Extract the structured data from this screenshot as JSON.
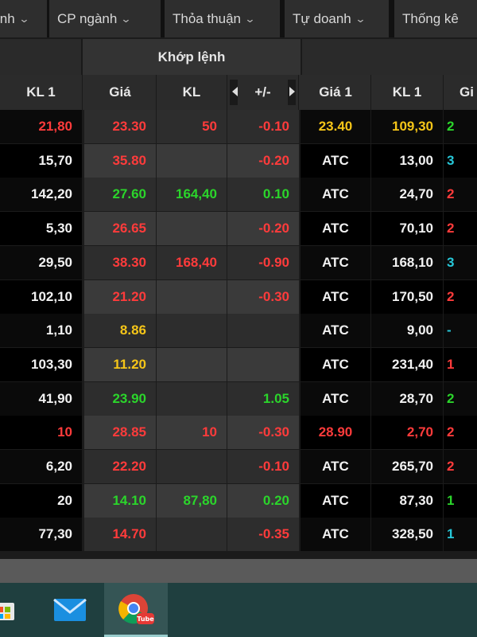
{
  "menu": {
    "items": [
      {
        "label": "inh"
      },
      {
        "label": "CP ngành"
      },
      {
        "label": "Thỏa thuận"
      },
      {
        "label": "Tự doanh"
      },
      {
        "label": "Thống kê"
      }
    ]
  },
  "group_header": {
    "khop_lenh": "Khớp lệnh"
  },
  "columns": {
    "kl1": "KL 1",
    "gia": "Giá",
    "kl": "KL",
    "pm": "+/-",
    "gia1": "Giá 1",
    "kl1b": "KL 1",
    "gi": "Gi"
  },
  "rows": [
    {
      "kl1": "21,80",
      "kl1_c": "red",
      "gia": "23.30",
      "gia_c": "red",
      "kl": "50",
      "kl_c": "red",
      "pm": "-0.10",
      "pm_c": "red",
      "gia1": "23.40",
      "gia1_c": "yellow",
      "kl1b": "109,30",
      "kl1b_c": "yellow",
      "gi": "2",
      "gi_c": "green"
    },
    {
      "kl1": "15,70",
      "kl1_c": "white",
      "gia": "35.80",
      "gia_c": "red",
      "kl": "",
      "kl_c": "white",
      "pm": "-0.20",
      "pm_c": "red",
      "gia1": "ATC",
      "gia1_c": "white",
      "kl1b": "13,00",
      "kl1b_c": "white",
      "gi": "3",
      "gi_c": "cyan"
    },
    {
      "kl1": "142,20",
      "kl1_c": "white",
      "gia": "27.60",
      "gia_c": "green",
      "kl": "164,40",
      "kl_c": "green",
      "pm": "0.10",
      "pm_c": "green",
      "gia1": "ATC",
      "gia1_c": "white",
      "kl1b": "24,70",
      "kl1b_c": "white",
      "gi": "2",
      "gi_c": "red"
    },
    {
      "kl1": "5,30",
      "kl1_c": "white",
      "gia": "26.65",
      "gia_c": "red",
      "kl": "",
      "kl_c": "white",
      "pm": "-0.20",
      "pm_c": "red",
      "gia1": "ATC",
      "gia1_c": "white",
      "kl1b": "70,10",
      "kl1b_c": "white",
      "gi": "2",
      "gi_c": "red"
    },
    {
      "kl1": "29,50",
      "kl1_c": "white",
      "gia": "38.30",
      "gia_c": "red",
      "kl": "168,40",
      "kl_c": "red",
      "pm": "-0.90",
      "pm_c": "red",
      "gia1": "ATC",
      "gia1_c": "white",
      "kl1b": "168,10",
      "kl1b_c": "white",
      "gi": "3",
      "gi_c": "cyan"
    },
    {
      "kl1": "102,10",
      "kl1_c": "white",
      "gia": "21.20",
      "gia_c": "red",
      "kl": "",
      "kl_c": "white",
      "pm": "-0.30",
      "pm_c": "red",
      "gia1": "ATC",
      "gia1_c": "white",
      "kl1b": "170,50",
      "kl1b_c": "white",
      "gi": "2",
      "gi_c": "red"
    },
    {
      "kl1": "1,10",
      "kl1_c": "white",
      "gia": "8.86",
      "gia_c": "yellow",
      "kl": "",
      "kl_c": "white",
      "pm": "",
      "pm_c": "white",
      "gia1": "ATC",
      "gia1_c": "white",
      "kl1b": "9,00",
      "kl1b_c": "white",
      "gi": "-",
      "gi_c": "cyan"
    },
    {
      "kl1": "103,30",
      "kl1_c": "white",
      "gia": "11.20",
      "gia_c": "yellow",
      "kl": "",
      "kl_c": "white",
      "pm": "",
      "pm_c": "white",
      "gia1": "ATC",
      "gia1_c": "white",
      "kl1b": "231,40",
      "kl1b_c": "white",
      "gi": "1",
      "gi_c": "red"
    },
    {
      "kl1": "41,90",
      "kl1_c": "white",
      "gia": "23.90",
      "gia_c": "green",
      "kl": "",
      "kl_c": "white",
      "pm": "1.05",
      "pm_c": "green",
      "gia1": "ATC",
      "gia1_c": "white",
      "kl1b": "28,70",
      "kl1b_c": "white",
      "gi": "2",
      "gi_c": "green"
    },
    {
      "kl1": "10",
      "kl1_c": "red",
      "gia": "28.85",
      "gia_c": "red",
      "kl": "10",
      "kl_c": "red",
      "pm": "-0.30",
      "pm_c": "red",
      "gia1": "28.90",
      "gia1_c": "red",
      "kl1b": "2,70",
      "kl1b_c": "red",
      "gi": "2",
      "gi_c": "red"
    },
    {
      "kl1": "6,20",
      "kl1_c": "white",
      "gia": "22.20",
      "gia_c": "red",
      "kl": "",
      "kl_c": "white",
      "pm": "-0.10",
      "pm_c": "red",
      "gia1": "ATC",
      "gia1_c": "white",
      "kl1b": "265,70",
      "kl1b_c": "white",
      "gi": "2",
      "gi_c": "red"
    },
    {
      "kl1": "20",
      "kl1_c": "white",
      "gia": "14.10",
      "gia_c": "green",
      "kl": "87,80",
      "kl_c": "green",
      "pm": "0.20",
      "pm_c": "green",
      "gia1": "ATC",
      "gia1_c": "white",
      "kl1b": "87,30",
      "kl1b_c": "white",
      "gi": "1",
      "gi_c": "green"
    },
    {
      "kl1": "77,30",
      "kl1_c": "white",
      "gia": "14.70",
      "gia_c": "red",
      "kl": "",
      "kl_c": "white",
      "pm": "-0.35",
      "pm_c": "red",
      "gia1": "ATC",
      "gia1_c": "white",
      "kl1b": "328,50",
      "kl1b_c": "white",
      "gi": "1",
      "gi_c": "cyan"
    }
  ],
  "taskbar": {
    "items": [
      {
        "icon": "store-icon"
      },
      {
        "icon": "mail-icon"
      },
      {
        "icon": "chrome-icon",
        "badge": "Tube"
      }
    ]
  },
  "colors": {
    "red": "#ff3b3b",
    "green": "#2bd52b",
    "yellow": "#f5c518",
    "cyan": "#27c7d8",
    "white": "#f2f2f2"
  }
}
